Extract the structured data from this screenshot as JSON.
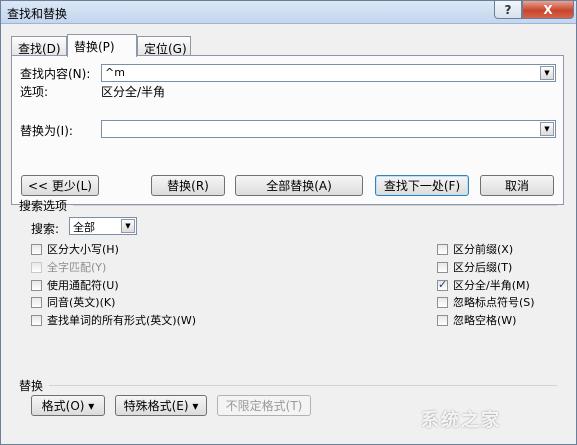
{
  "window": {
    "title": "查找和替换",
    "help_label": "?",
    "close_label": "X"
  },
  "tabs": [
    {
      "label": "查找(D)"
    },
    {
      "label": "替换(P)"
    },
    {
      "label": "定位(G)"
    }
  ],
  "find": {
    "label": "查找内容(N):",
    "value": "^m"
  },
  "options": {
    "label": "选项:",
    "value": "区分全/半角"
  },
  "replace": {
    "label": "替换为(I):",
    "value": ""
  },
  "buttons": {
    "less": "<< 更少(L)",
    "replace": "替换(R)",
    "replace_all": "全部替换(A)",
    "find_next": "查找下一处(F)",
    "cancel": "取消"
  },
  "search_options": {
    "title": "搜索选项",
    "search_label": "搜索:",
    "search_value": "全部",
    "left": [
      {
        "label": "区分大小写(H)",
        "checked": false,
        "disabled": false
      },
      {
        "label": "全字匹配(Y)",
        "checked": false,
        "disabled": true
      },
      {
        "label": "使用通配符(U)",
        "checked": false,
        "disabled": false
      },
      {
        "label": "同音(英文)(K)",
        "checked": false,
        "disabled": false
      },
      {
        "label": "查找单词的所有形式(英文)(W)",
        "checked": false,
        "disabled": false
      }
    ],
    "right": [
      {
        "label": "区分前缀(X)",
        "checked": false,
        "disabled": false
      },
      {
        "label": "区分后缀(T)",
        "checked": false,
        "disabled": false
      },
      {
        "label": "区分全/半角(M)",
        "checked": true,
        "disabled": false
      },
      {
        "label": "忽略标点符号(S)",
        "checked": false,
        "disabled": false
      },
      {
        "label": "忽略空格(W)",
        "checked": false,
        "disabled": false
      }
    ]
  },
  "replace_section": {
    "title": "替换",
    "format": "格式(O) ▾",
    "special": "特殊格式(E) ▾",
    "no_format": "不限定格式(T)"
  },
  "watermark": "系统之家"
}
